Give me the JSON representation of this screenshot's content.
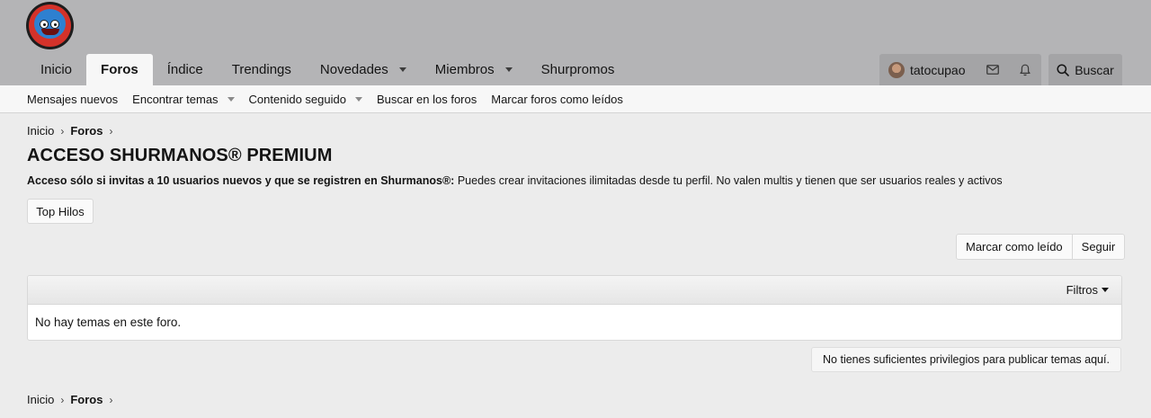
{
  "header": {
    "nav": [
      {
        "label": "Inicio",
        "active": false,
        "dropdown": false
      },
      {
        "label": "Foros",
        "active": true,
        "dropdown": false
      },
      {
        "label": "Índice",
        "active": false,
        "dropdown": false
      },
      {
        "label": "Trendings",
        "active": false,
        "dropdown": false
      },
      {
        "label": "Novedades",
        "active": false,
        "dropdown": true
      },
      {
        "label": "Miembros",
        "active": false,
        "dropdown": true
      },
      {
        "label": "Shurpromos",
        "active": false,
        "dropdown": false
      }
    ],
    "user": {
      "name": "tatocupao"
    },
    "search_label": "Buscar"
  },
  "subnav": [
    {
      "label": "Mensajes nuevos",
      "dropdown": false
    },
    {
      "label": "Encontrar temas",
      "dropdown": true
    },
    {
      "label": "Contenido seguido",
      "dropdown": true
    },
    {
      "label": "Buscar en los foros",
      "dropdown": false
    },
    {
      "label": "Marcar foros como leídos",
      "dropdown": false
    }
  ],
  "breadcrumb": {
    "home": "Inicio",
    "section": "Foros"
  },
  "forum": {
    "title": "ACCESO SHURMANOS® PREMIUM",
    "desc_bold": "Acceso sólo si invitas a 10 usuarios nuevos y que se registren en Shurmanos®:",
    "desc_rest": " Puedes crear invitaciones ilimitadas desde tu perfil. No valen multis y tienen que ser usuarios reales y activos"
  },
  "buttons": {
    "top_hilos": "Top Hilos",
    "mark_read": "Marcar como leído",
    "follow": "Seguir",
    "filters": "Filtros"
  },
  "threads": {
    "empty_message": "No hay temas en este foro."
  },
  "notice": "No tienes suficientes privilegios para publicar temas aquí.",
  "colors": {
    "header_bg": "#b4b4b6",
    "page_bg": "#ececec",
    "active_tab": "#f7f7f7"
  }
}
